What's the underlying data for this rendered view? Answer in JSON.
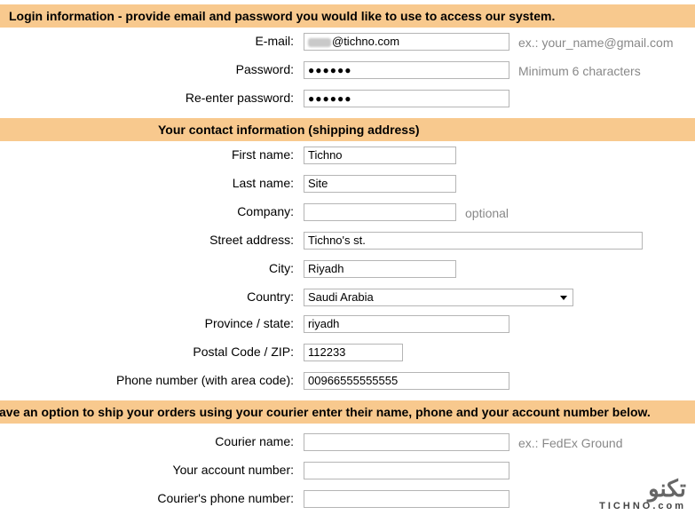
{
  "login": {
    "header": "Login information - provide email and password you would like to use to access our system.",
    "email_label": "E-mail:",
    "email_value": "@tichno.com",
    "email_hint": "ex.: your_name@gmail.com",
    "password_label": "Password:",
    "password_value": "●●●●●●",
    "password_hint": "Minimum 6 characters",
    "reenter_label": "Re-enter password:",
    "reenter_value": "●●●●●●"
  },
  "contact": {
    "header": "Your contact information (shipping address)",
    "first_name_label": "First name:",
    "first_name_value": "Tichno",
    "last_name_label": "Last name:",
    "last_name_value": "Site",
    "company_label": "Company:",
    "company_value": "",
    "company_hint": "optional",
    "street_label": "Street address:",
    "street_value": "Tichno's st.",
    "city_label": "City:",
    "city_value": "Riyadh",
    "country_label": "Country:",
    "country_value": "Saudi Arabia",
    "province_label": "Province / state:",
    "province_value": "riyadh",
    "postal_label": "Postal Code / ZIP:",
    "postal_value": "112233",
    "phone_label": "Phone number (with area code):",
    "phone_value": "00966555555555"
  },
  "courier": {
    "header": "ave an option to ship your orders using your courier enter their name, phone and your account number below.",
    "name_label": "Courier name:",
    "name_value": "",
    "name_hint": "ex.: FedEx Ground",
    "account_label": "Your account number:",
    "account_value": "",
    "phone_label": "Courier's phone number:",
    "phone_value": ""
  },
  "watermark": {
    "arabic": "تكنو",
    "latin": "TICHNO.com"
  }
}
